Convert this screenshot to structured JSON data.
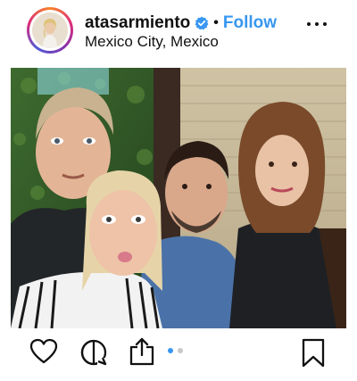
{
  "header": {
    "username": "atasarmiento",
    "separator": "•",
    "follow_label": "Follow",
    "location": "Mexico City, Mexico",
    "verified_icon": "verified-badge-icon",
    "more_icon": "more-options-icon"
  },
  "post": {
    "image_description_icon": "group-selfie-photo",
    "carousel": {
      "count": 2,
      "active": 1
    }
  },
  "actions": {
    "like_icon": "heart-icon",
    "comment_icon": "comment-icon",
    "share_icon": "share-icon",
    "save_icon": "bookmark-icon"
  },
  "colors": {
    "follow": "#3897f0",
    "active_dot": "#3897f0",
    "inactive_dot": "#c7c7c7"
  }
}
